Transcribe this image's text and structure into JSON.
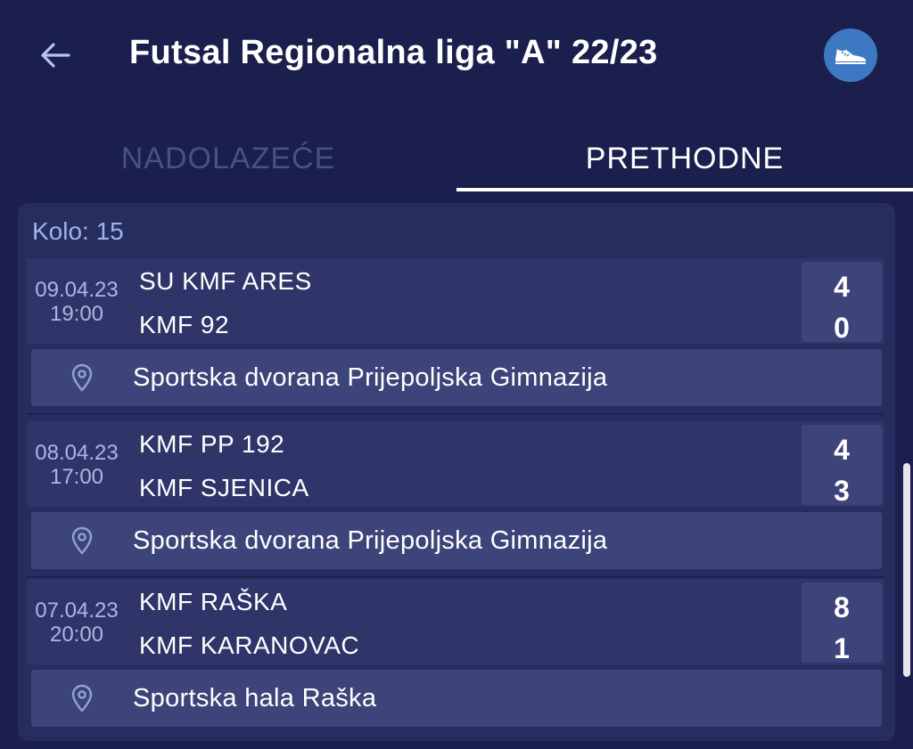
{
  "header": {
    "title": "Futsal Regionalna liga \"A\" 22/23",
    "back_icon": "arrow-left-icon",
    "avatar_icon": "sneaker-icon"
  },
  "tabs": [
    {
      "label": "NADOLAZEĆE",
      "active": false
    },
    {
      "label": "PRETHODNE",
      "active": true
    }
  ],
  "round": {
    "label": "Kolo: 15",
    "matches": [
      {
        "date": "09.04.23",
        "time": "19:00",
        "home": "SU KMF ARES",
        "away": "KMF 92",
        "home_score": "4",
        "away_score": "0",
        "venue": "Sportska dvorana Prijepoljska Gimnazija"
      },
      {
        "date": "08.04.23",
        "time": "17:00",
        "home": "KMF PP 192",
        "away": "KMF SJENICA",
        "home_score": "4",
        "away_score": "3",
        "venue": "Sportska dvorana Prijepoljska Gimnazija"
      },
      {
        "date": "07.04.23",
        "time": "20:00",
        "home": "KMF RAŠKA",
        "away": "KMF KARANOVAC",
        "home_score": "8",
        "away_score": "1",
        "venue": "Sportska hala Raška"
      }
    ]
  },
  "colors": {
    "background": "#1a1f4d",
    "card": "#272d5e",
    "accent": "#3d79c2",
    "venue_bg": "#3d4479"
  }
}
